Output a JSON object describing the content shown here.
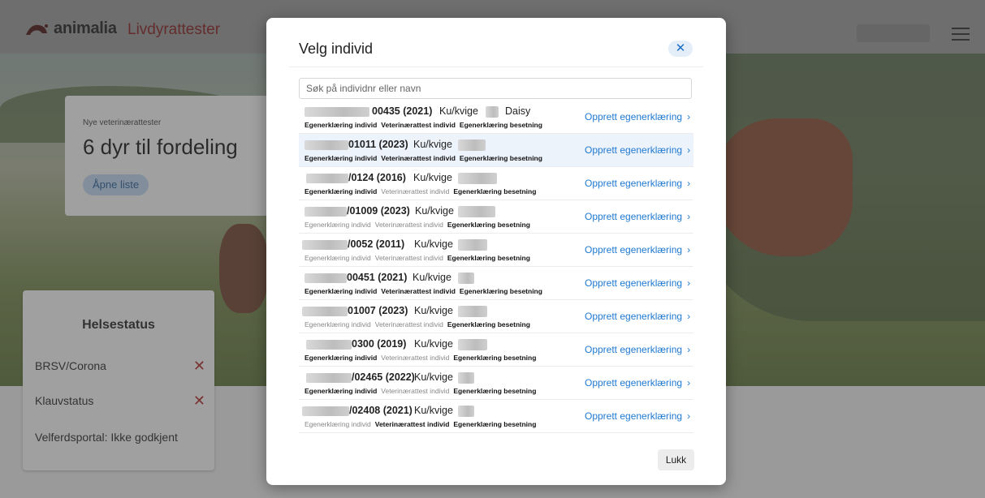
{
  "header": {
    "brand": "animalia",
    "product": "Livdyrattester"
  },
  "vet_card": {
    "kicker": "Nye veterinærattester",
    "headline": "6 dyr til fordeling",
    "button": "Åpne liste"
  },
  "health_card": {
    "title": "Helsestatus",
    "rows": [
      {
        "label": "BRSV/Corona",
        "status": "✕"
      },
      {
        "label": "Klauvstatus",
        "status": "✕"
      },
      {
        "label": "Velferdsportal: Ikke godkjent",
        "status": ""
      }
    ]
  },
  "modal": {
    "title": "Velg individ",
    "close_icon": "✕",
    "search_placeholder": "Søk på individnr eller navn",
    "tag_labels": [
      "Egenerklæring individ",
      "Veterinærattest individ",
      "Egenerklæring besetning"
    ],
    "link_label": "Opprett egenerklæring",
    "link_chevron": "›",
    "close_button": "Lukk",
    "items": [
      {
        "id": "00435 (2021)",
        "type": "Ku/kvige",
        "name": "Daisy",
        "tags": [
          true,
          true,
          true
        ]
      },
      {
        "id": "01011 (2023)",
        "type": "Ku/kvige",
        "name": "",
        "tags": [
          true,
          true,
          true
        ]
      },
      {
        "id": "/0124 (2016)",
        "type": "Ku/kvige",
        "name": "",
        "tags": [
          true,
          false,
          true
        ]
      },
      {
        "id": "/01009 (2023)",
        "type": "Ku/kvige",
        "name": "",
        "tags": [
          false,
          false,
          true
        ]
      },
      {
        "id": "/0052 (2011)",
        "type": "Ku/kvige",
        "name": "",
        "tags": [
          false,
          false,
          true
        ]
      },
      {
        "id": "00451 (2021)",
        "type": "Ku/kvige",
        "name": "",
        "tags": [
          true,
          true,
          true
        ]
      },
      {
        "id": "01007 (2023)",
        "type": "Ku/kvige",
        "name": "",
        "tags": [
          false,
          false,
          true
        ]
      },
      {
        "id": "0300 (2019)",
        "type": "Ku/kvige",
        "name": "",
        "tags": [
          true,
          false,
          true
        ]
      },
      {
        "id": "/02465 (2022)",
        "type": "Ku/kvige",
        "name": "",
        "tags": [
          true,
          false,
          true
        ]
      },
      {
        "id": "/02408 (2021)",
        "type": "Ku/kvige",
        "name": "",
        "tags": [
          false,
          true,
          true
        ]
      }
    ]
  }
}
